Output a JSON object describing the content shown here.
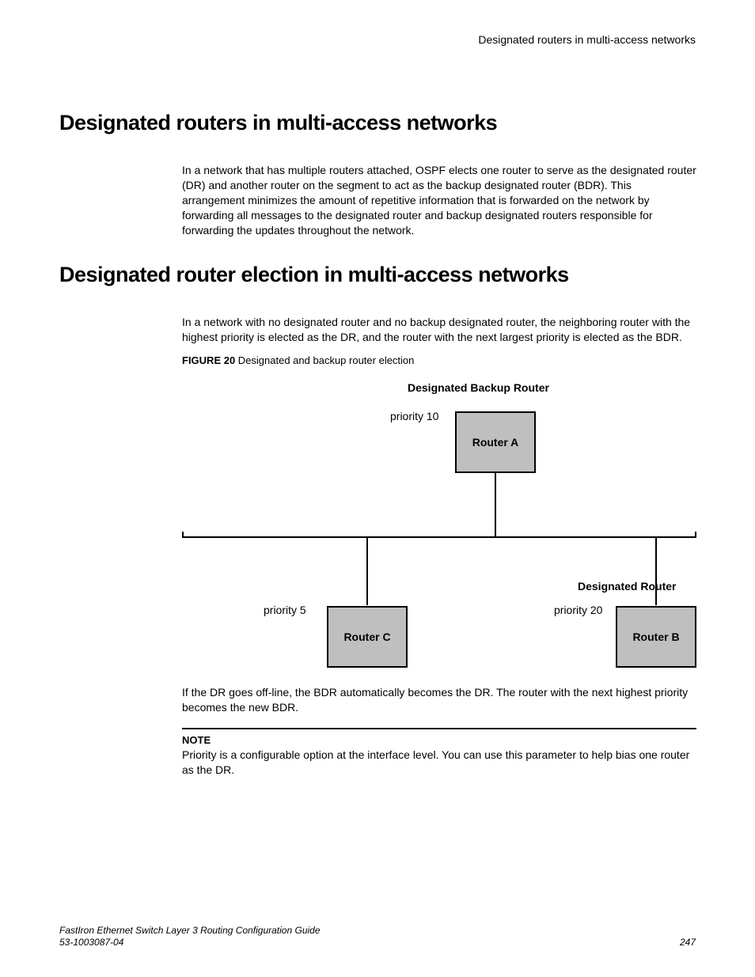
{
  "header": {
    "running_title": "Designated routers in multi-access networks"
  },
  "section1": {
    "title": "Designated routers in multi-access networks",
    "body": "In a network that has multiple routers attached, OSPF elects one router to serve as the designated router (DR) and another router on the segment to act as the backup designated router (BDR). This arrangement minimizes the amount of repetitive information that is forwarded on the network by forwarding all messages to the designated router and backup designated routers responsible for forwarding the updates throughout the network."
  },
  "section2": {
    "title": "Designated router election in multi-access networks",
    "body": "In a network with no designated router and no backup designated router, the neighboring router with the highest priority is elected as the DR, and the router with the next largest priority is elected as the BDR."
  },
  "figure": {
    "label": "FIGURE 20",
    "caption": " Designated and backup router election",
    "dbr_label": "Designated Backup Router",
    "dr_label": "Designated Router",
    "routerA": {
      "name": "Router A",
      "priority_label": "priority 10"
    },
    "routerB": {
      "name": "Router B",
      "priority_label": "priority 20"
    },
    "routerC": {
      "name": "Router C",
      "priority_label": "priority 5"
    }
  },
  "after_figure": "If the DR goes off-line, the BDR automatically becomes the DR. The router with the next highest priority becomes the new BDR.",
  "note": {
    "label": "NOTE",
    "text": "Priority is a configurable option at the interface level. You can use this parameter to help bias one router as the DR."
  },
  "footer": {
    "doc_title": "FastIron Ethernet Switch Layer 3 Routing Configuration Guide",
    "doc_number": "53-1003087-04",
    "page": "247"
  }
}
